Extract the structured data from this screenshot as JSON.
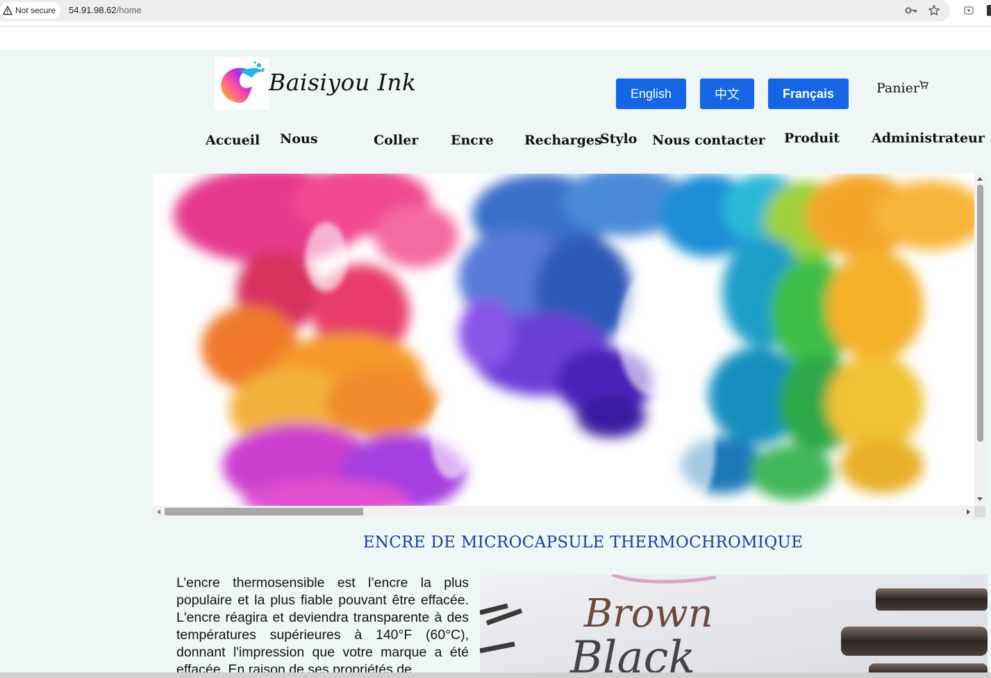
{
  "browser": {
    "security_label": "Not secure",
    "url_host": "54.91.98.62",
    "url_path": "/home"
  },
  "header": {
    "brand": "Baisiyou Ink",
    "languages": [
      "English",
      "中文",
      "Français"
    ],
    "active_language": "Français",
    "cart_label": "Panier"
  },
  "nav": {
    "items": [
      "Accueil",
      "Nous",
      "Coller",
      "Encre",
      "Recharges",
      "Stylo",
      "Nous contacter",
      "Produit",
      "Administrateur"
    ]
  },
  "main": {
    "section_title": "ENCRE DE MICROCAPSULE THERMOCHROMIQUE",
    "paragraph": "L’encre thermosensible est l’encre la plus populaire et la plus fiable pouvant être effacée. L'encre réagira et deviendra transparente à des températures supérieures à 140°F (60°C), donnant l'impression que votre marque a été effacée. En raison de ses propriétés de",
    "photo_words": [
      "Brown",
      "Black"
    ]
  },
  "colors": {
    "accent_blue": "#1466e6",
    "title_blue": "#1e3a9a",
    "page_bg": "#eef7f5"
  },
  "icons": [
    "warning-icon",
    "key-icon",
    "star-icon",
    "extension-icon",
    "cart-icon"
  ]
}
